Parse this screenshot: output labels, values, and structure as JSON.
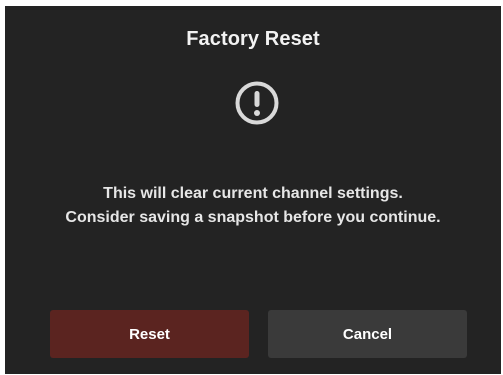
{
  "dialog": {
    "title": "Factory Reset",
    "icon": "exclamation-circle-icon",
    "message_lines": [
      "This will clear current channel settings.",
      "Consider saving a snapshot before you continue."
    ],
    "buttons": {
      "reset_label": "Reset",
      "cancel_label": "Cancel"
    }
  },
  "colors": {
    "background": "#232323",
    "reset_button": "#5b2420",
    "cancel_button": "#3a3a3a",
    "text": "#f2f2f2",
    "icon": "#d9d9d9"
  }
}
